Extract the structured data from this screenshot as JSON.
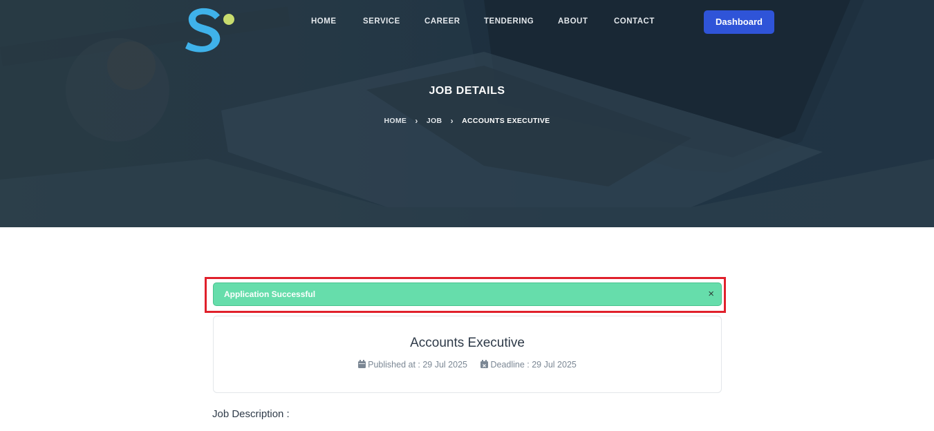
{
  "header": {
    "nav": [
      "HOME",
      "SERVICE",
      "CAREER",
      "TENDERING",
      "ABOUT",
      "CONTACT"
    ],
    "dashboard_label": "Dashboard"
  },
  "hero": {
    "title": "JOB DETAILS",
    "breadcrumb": [
      "HOME",
      "JOB",
      "ACCOUNTS EXECUTIVE"
    ]
  },
  "alert": {
    "message": "Application Successful",
    "close_symbol": "×"
  },
  "job": {
    "title": "Accounts Executive",
    "published": "Published at : 29 Jul 2025",
    "deadline": "Deadline : 29 Jul 2025"
  },
  "description_label": "Job Description :",
  "icons": {
    "published": "calendar-icon",
    "deadline": "calendar-x-icon",
    "logo": "s-logo-icon",
    "breadcrumb_separator": "chevron-right-icon"
  },
  "colors": {
    "primary": "#2f54d8",
    "success": "#66ddab",
    "logo_blue": "#3fb2ea",
    "logo_dot": "#c8dc6e",
    "highlight": "#e0202b"
  }
}
